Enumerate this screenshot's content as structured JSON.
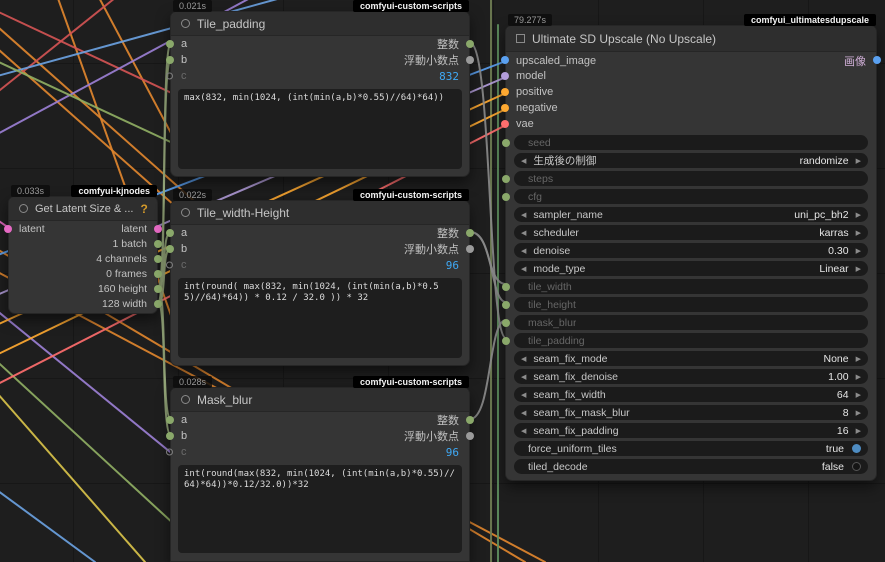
{
  "icons": {
    "combo_prev": "◀",
    "combo_next": "▶",
    "help": "?"
  },
  "colors": {
    "result_value": "#3fa9f5",
    "badge_bg": "#000000",
    "slot_image": "#5aa0f0",
    "slot_model": "#b39ddb",
    "slot_conditioning": "#ffa931",
    "slot_vae": "#ff6e6e",
    "slot_latent": "#e569c3",
    "slot_int": "#8aa86a",
    "toggle_on": "#4e8cc2"
  },
  "nodes": {
    "tile_padding": {
      "timer": "0.021s",
      "badge": "comfyui-custom-scripts",
      "title": "Tile_padding",
      "inputs": [
        "a",
        "b",
        "c"
      ],
      "outputs": [
        "整数",
        "浮動小数点"
      ],
      "result": "832",
      "expression": "max(832, min(1024, (int(min(a,b)*0.55)//64)*64))"
    },
    "get_latent_size": {
      "timer": "0.033s",
      "badge": "comfyui-kjnodes",
      "title": "Get Latent Size & ...",
      "input": "latent",
      "outputs": [
        "latent",
        "1 batch",
        "4 channels",
        "0 frames",
        "160 height",
        "128 width"
      ]
    },
    "tile_width_height": {
      "timer": "0.022s",
      "badge": "comfyui-custom-scripts",
      "title": "Tile_width-Height",
      "inputs": [
        "a",
        "b",
        "c"
      ],
      "outputs": [
        "整数",
        "浮動小数点"
      ],
      "result": "96",
      "expression": "int(round( max(832, min(1024, (int(min(a,b)*0.55)//64)*64)) * 0.12 / 32.0 )) * 32"
    },
    "mask_blur": {
      "timer": "0.028s",
      "badge": "comfyui-custom-scripts",
      "title": "Mask_blur",
      "inputs": [
        "a",
        "b",
        "c"
      ],
      "outputs": [
        "整数",
        "浮動小数点"
      ],
      "result": "96",
      "expression": "int(round(max(832, min(1024, (int(min(a,b)*0.55)//64)*64))*0.12/32.0))*32"
    },
    "ultimate_sd_upscale": {
      "timer": "79.277s",
      "badge": "comfyui_ultimatesdupscale",
      "title": "Ultimate SD Upscale (No Upscale)",
      "output": "画像",
      "inputs": [
        "upscaled_image",
        "model",
        "positive",
        "negative",
        "vae"
      ],
      "widgets": [
        {
          "label": "seed",
          "type": "converted"
        },
        {
          "label": "生成後の制御",
          "value": "randomize",
          "type": "combo"
        },
        {
          "label": "steps",
          "type": "converted"
        },
        {
          "label": "cfg",
          "type": "converted"
        },
        {
          "label": "sampler_name",
          "value": "uni_pc_bh2",
          "type": "combo"
        },
        {
          "label": "scheduler",
          "value": "karras",
          "type": "combo"
        },
        {
          "label": "denoise",
          "value": "0.30",
          "type": "number"
        },
        {
          "label": "mode_type",
          "value": "Linear",
          "type": "combo"
        },
        {
          "label": "tile_width",
          "type": "converted"
        },
        {
          "label": "tile_height",
          "type": "converted"
        },
        {
          "label": "mask_blur",
          "type": "converted"
        },
        {
          "label": "tile_padding",
          "type": "converted"
        },
        {
          "label": "seam_fix_mode",
          "value": "None",
          "type": "combo"
        },
        {
          "label": "seam_fix_denoise",
          "value": "1.00",
          "type": "number"
        },
        {
          "label": "seam_fix_width",
          "value": "64",
          "type": "number"
        },
        {
          "label": "seam_fix_mask_blur",
          "value": "8",
          "type": "number"
        },
        {
          "label": "seam_fix_padding",
          "value": "16",
          "type": "number"
        },
        {
          "label": "force_uniform_tiles",
          "value": "true",
          "type": "toggle"
        },
        {
          "label": "tiled_decode",
          "value": "false",
          "type": "toggle"
        }
      ]
    }
  }
}
